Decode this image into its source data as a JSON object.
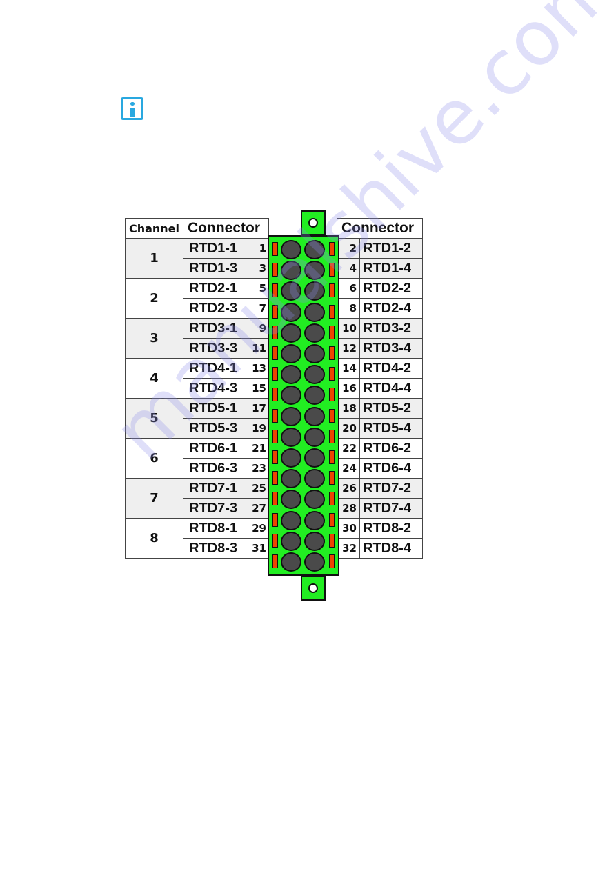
{
  "note_icon": "info-icon",
  "table": {
    "headers": {
      "channel": "Channel",
      "connector_left": "Connector",
      "connector_right": "Connector"
    },
    "channels": [
      {
        "channel": "1",
        "rows": [
          {
            "left": "RTD1-1",
            "lpin": "1",
            "rpin": "2",
            "right": "RTD1-2"
          },
          {
            "left": "RTD1-3",
            "lpin": "3",
            "rpin": "4",
            "right": "RTD1-4"
          }
        ]
      },
      {
        "channel": "2",
        "rows": [
          {
            "left": "RTD2-1",
            "lpin": "5",
            "rpin": "6",
            "right": "RTD2-2"
          },
          {
            "left": "RTD2-3",
            "lpin": "7",
            "rpin": "8",
            "right": "RTD2-4"
          }
        ]
      },
      {
        "channel": "3",
        "rows": [
          {
            "left": "RTD3-1",
            "lpin": "9",
            "rpin": "10",
            "right": "RTD3-2"
          },
          {
            "left": "RTD3-3",
            "lpin": "11",
            "rpin": "12",
            "right": "RTD3-4"
          }
        ]
      },
      {
        "channel": "4",
        "rows": [
          {
            "left": "RTD4-1",
            "lpin": "13",
            "rpin": "14",
            "right": "RTD4-2"
          },
          {
            "left": "RTD4-3",
            "lpin": "15",
            "rpin": "16",
            "right": "RTD4-4"
          }
        ]
      },
      {
        "channel": "5",
        "rows": [
          {
            "left": "RTD5-1",
            "lpin": "17",
            "rpin": "18",
            "right": "RTD5-2"
          },
          {
            "left": "RTD5-3",
            "lpin": "19",
            "rpin": "20",
            "right": "RTD5-4"
          }
        ]
      },
      {
        "channel": "6",
        "rows": [
          {
            "left": "RTD6-1",
            "lpin": "21",
            "rpin": "22",
            "right": "RTD6-2"
          },
          {
            "left": "RTD6-3",
            "lpin": "23",
            "rpin": "24",
            "right": "RTD6-4"
          }
        ]
      },
      {
        "channel": "7",
        "rows": [
          {
            "left": "RTD7-1",
            "lpin": "25",
            "rpin": "26",
            "right": "RTD7-2"
          },
          {
            "left": "RTD7-3",
            "lpin": "27",
            "rpin": "28",
            "right": "RTD7-4"
          }
        ]
      },
      {
        "channel": "8",
        "rows": [
          {
            "left": "RTD8-1",
            "lpin": "29",
            "rpin": "30",
            "right": "RTD8-2"
          },
          {
            "left": "RTD8-3",
            "lpin": "31",
            "rpin": "32",
            "right": "RTD8-4"
          }
        ]
      }
    ]
  },
  "connector": {
    "pin_rows": 16,
    "body_color": "#22ee22",
    "latch_color": "#ee4400",
    "hole_color": "#4a4a4a"
  },
  "watermark": "manualshive.com"
}
